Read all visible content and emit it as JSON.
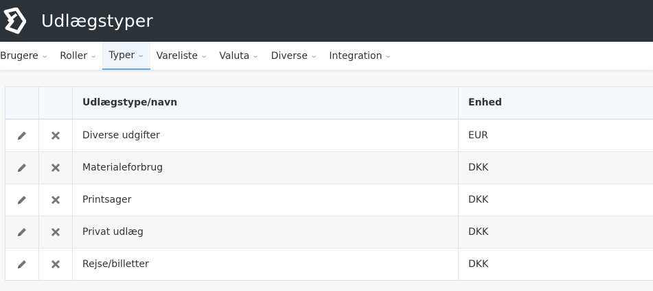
{
  "header": {
    "title": "Udlægstyper",
    "logo_icon": "app-logo-icon"
  },
  "nav": [
    {
      "label": "Brugere",
      "active": false
    },
    {
      "label": "Roller",
      "active": false
    },
    {
      "label": "Typer",
      "active": true
    },
    {
      "label": "Vareliste",
      "active": false
    },
    {
      "label": "Valuta",
      "active": false
    },
    {
      "label": "Diverse",
      "active": false
    },
    {
      "label": "Integration",
      "active": false
    }
  ],
  "table": {
    "columns": [
      "",
      "",
      "Udlægstype/navn",
      "Enhed"
    ],
    "rows": [
      {
        "name": "Diverse udgifter",
        "unit": "EUR"
      },
      {
        "name": "Materialeforbrug",
        "unit": "DKK"
      },
      {
        "name": "Printsager",
        "unit": "DKK"
      },
      {
        "name": "Privat udlæg",
        "unit": "DKK"
      },
      {
        "name": "Rejse/billetter",
        "unit": "DKK"
      }
    ]
  },
  "colors": {
    "topbar": "#2b3238",
    "accent": "#6aa7d8"
  }
}
